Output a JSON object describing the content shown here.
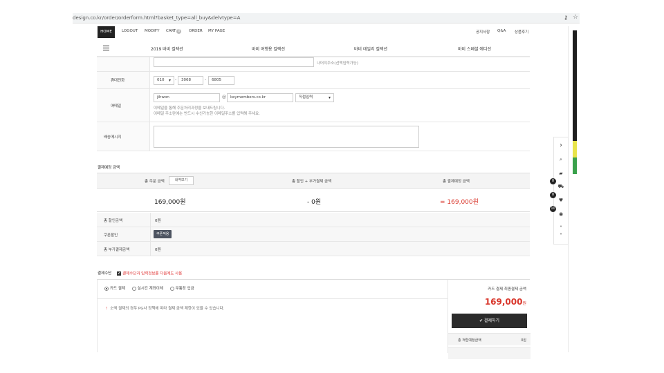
{
  "browser": {
    "url": "design.co.kr/order/orderform.html?basket_type=all_buy&delvtype=A",
    "key_icon": "key-icon",
    "star_icon": "star-icon"
  },
  "topnav": {
    "home": "HOME",
    "logout": "LOGOUT",
    "modify": "MODIFY",
    "cart": "CART",
    "cart_count": "0",
    "order": "ORDER",
    "mypage": "MY PAGE",
    "notice": "공지사항",
    "qna": "Q&A",
    "review": "상품후기"
  },
  "catnav": {
    "items": [
      "2019 바비 컬렉션",
      "바비 여행용 컬렉션",
      "바비 데일리 컬렉션",
      "바비 스페셜 에디션"
    ]
  },
  "form": {
    "address_detail_note": "나머지주소(선택입력가능)",
    "mobile": {
      "label": "휴대전화",
      "required_mark": "•",
      "prefix": "010",
      "middle": "3068",
      "last": "6805",
      "dash": "-"
    },
    "email": {
      "label": "이메일",
      "required_mark": "•",
      "id": "jihwon",
      "at": "@",
      "domain": "keymembers.co.kr",
      "domain_select": "직접입력",
      "note1": "이메일을 통해 주문처리과정을 보내드립니다.",
      "note2": "이메일 주소란에는 반드시 수신가능한 이메일주소를 입력해 주세요."
    },
    "message": {
      "label": "배송메시지",
      "value": ""
    }
  },
  "payment_summary": {
    "section_title": "결제예정 금액",
    "col_order_total": "총 주문 금액",
    "detail_button": "내역보기",
    "col_discount": "총 할인 + 부가결제 금액",
    "col_final": "총 결제예정 금액",
    "order_total": "169,000원",
    "discount": "- 0원",
    "final": "= 169,000원",
    "rows": [
      {
        "key": "총 할인금액",
        "value": "0원"
      },
      {
        "key": "쿠폰할인",
        "button": "쿠폰적용"
      },
      {
        "key": "총 부가결제금액",
        "value": "0원"
      }
    ]
  },
  "payment_method": {
    "section_title": "결제수단",
    "remember_label": "결제수단과 입력정보를 다음에도 사용",
    "methods": [
      "카드 결제",
      "실시간 계좌이체",
      "무통장 입금"
    ],
    "selected_index": 0,
    "pg_notice_mark": "!",
    "pg_notice": "소액 결제의 경우 PG사 정책에 따라 결제 금액 제한이 있을 수 있습니다.",
    "right_title": "카드 결제 최종결제 금액",
    "right_amount": "169,000",
    "right_amount_unit": "원",
    "pay_button": "✔ 결제하기",
    "points_label": "총 적립예정금액",
    "points_value": "0원"
  },
  "quick_menu": {
    "badges": [
      "0",
      "0",
      "10"
    ]
  },
  "colors": {
    "accent_red": "#d9362b",
    "button_dark": "#2b2b2b"
  }
}
